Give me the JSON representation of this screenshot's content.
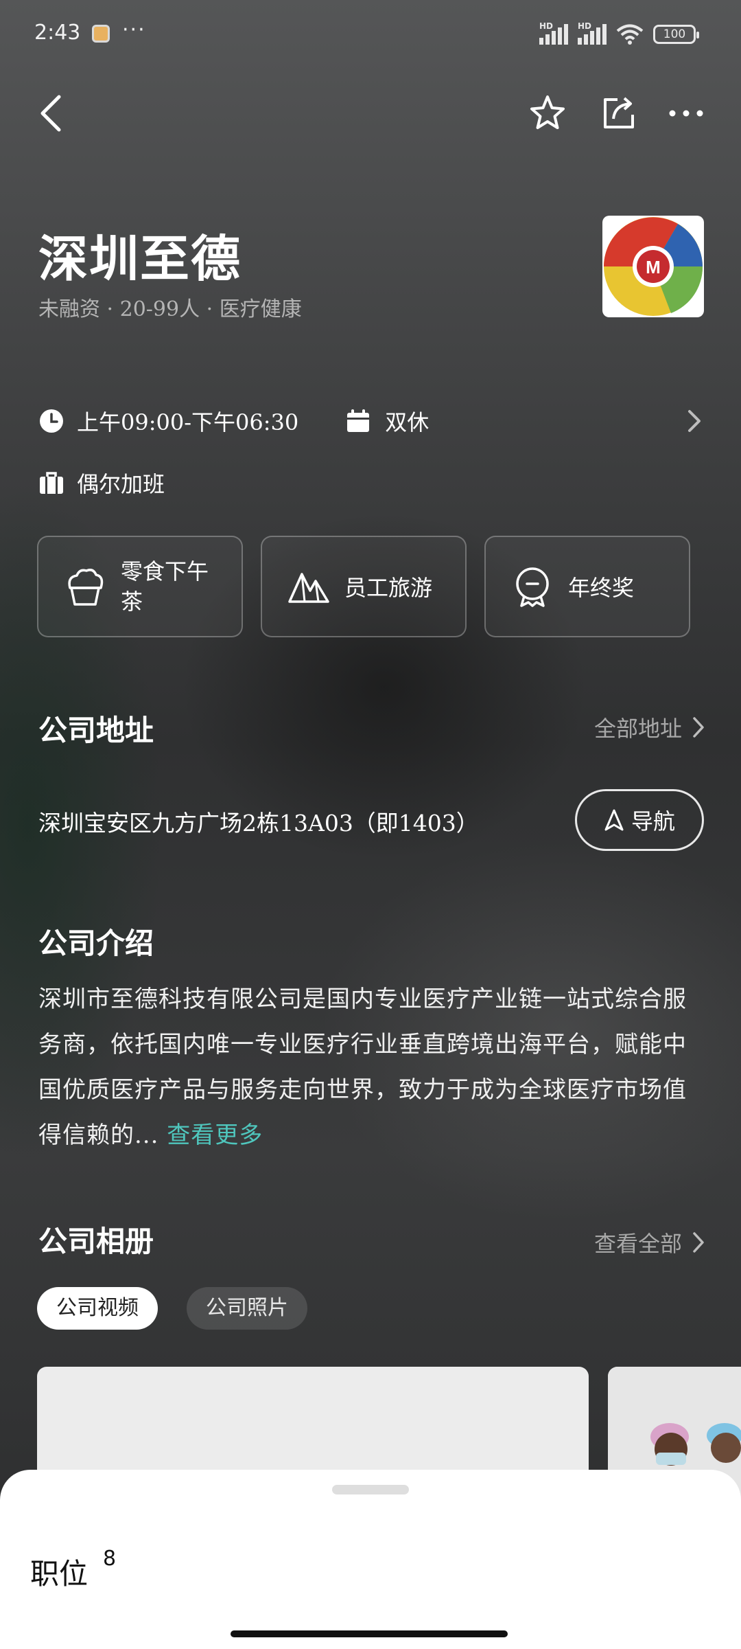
{
  "status_bar": {
    "time": "2:43",
    "more": "···",
    "battery": "100",
    "hd1": "HD",
    "hd2": "HD"
  },
  "company": {
    "name": "深圳至德",
    "meta": "未融资 · 20-99人 · 医疗健康",
    "logo_text": "M"
  },
  "work": {
    "hours": "上午09:00-下午06:30",
    "rest": "双休",
    "overtime": "偶尔加班"
  },
  "benefits": [
    {
      "label": "零食下午茶",
      "icon": "cupcake-icon"
    },
    {
      "label": "员工旅游",
      "icon": "mountain-icon"
    },
    {
      "label": "年终奖",
      "icon": "medal-icon"
    }
  ],
  "address_section": {
    "title": "公司地址",
    "link": "全部地址",
    "address": "深圳宝安区九方广场2栋13A03（即1403）",
    "nav_button": "导航"
  },
  "intro_section": {
    "title": "公司介绍",
    "text": "深圳市至德科技有限公司是国内专业医疗产业链一站式综合服务商，依托国内唯一专业医疗行业垂直跨境出海平台，赋能中国优质医疗产品与服务走向世界，致力于成为全球医疗市场值得信赖的...",
    "more": "查看更多"
  },
  "album_section": {
    "title": "公司相册",
    "link": "查看全部",
    "tabs": [
      "公司视频",
      "公司照片"
    ]
  },
  "bottom_sheet": {
    "label": "职位",
    "count": "8"
  },
  "colors": {
    "accent": "#4fc6bd",
    "sheet": "#ffffff"
  }
}
